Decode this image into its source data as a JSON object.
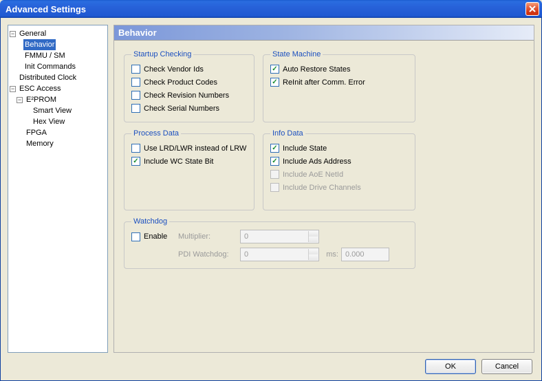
{
  "window": {
    "title": "Advanced Settings"
  },
  "tree": {
    "general": "General",
    "behavior": "Behavior",
    "fmmu": "FMMU / SM",
    "init": "Init Commands",
    "distclock": "Distributed Clock",
    "esc": "ESC Access",
    "eeprom": "E²PROM",
    "smartview": "Smart View",
    "hexview": "Hex View",
    "fpga": "FPGA",
    "memory": "Memory"
  },
  "panel": {
    "title": "Behavior"
  },
  "groups": {
    "startup": {
      "legend": "Startup Checking",
      "vendor": "Check Vendor Ids",
      "product": "Check Product Codes",
      "revision": "Check Revision Numbers",
      "serial": "Check Serial Numbers"
    },
    "state": {
      "legend": "State Machine",
      "auto": "Auto Restore States",
      "reinit": "ReInit after Comm. Error"
    },
    "process": {
      "legend": "Process Data",
      "lrd": "Use LRD/LWR instead of LRW",
      "wc": "Include WC State Bit"
    },
    "info": {
      "legend": "Info Data",
      "state": "Include State",
      "ads": "Include Ads Address",
      "aoe": "Include AoE NetId",
      "drive": "Include Drive Channels"
    },
    "watchdog": {
      "legend": "Watchdog",
      "enable": "Enable",
      "multiplier": "Multiplier:",
      "pdi": "PDI Watchdog:",
      "ms": "ms:",
      "mult_val": "0",
      "pdi_val": "0",
      "ms_val": "0.000"
    }
  },
  "buttons": {
    "ok": "OK",
    "cancel": "Cancel"
  }
}
